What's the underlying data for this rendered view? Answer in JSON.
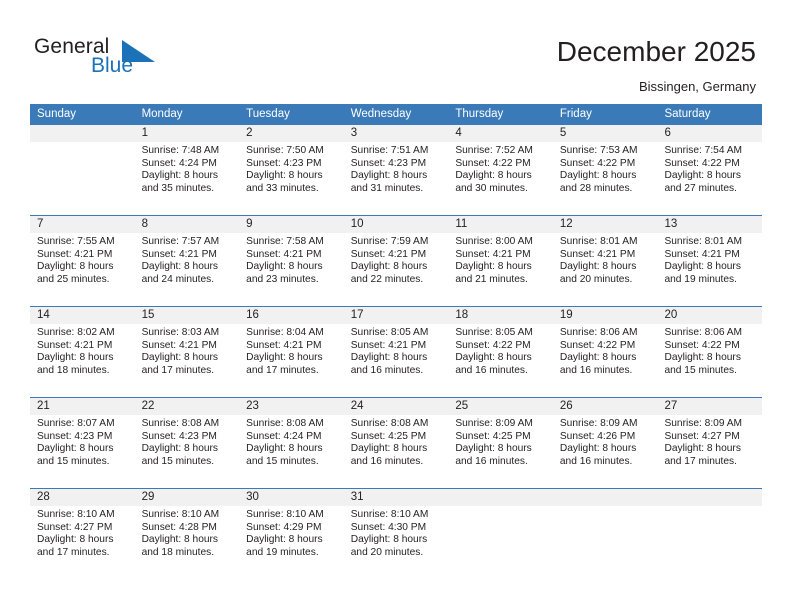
{
  "brand": {
    "name_part1": "General",
    "name_part2": "Blue",
    "mark_icon": "triangle-flag-icon"
  },
  "header": {
    "title": "December 2025",
    "subtitle": "Bissingen, Germany"
  },
  "calendar": {
    "day_headers": [
      "Sunday",
      "Monday",
      "Tuesday",
      "Wednesday",
      "Thursday",
      "Friday",
      "Saturday"
    ],
    "colors": {
      "header_blue": "#3b7ab8",
      "date_band": "#f1f1f1",
      "text": "#231f20",
      "brand_blue": "#1b72b8"
    },
    "weeks": [
      {
        "dates": [
          "",
          "1",
          "2",
          "3",
          "4",
          "5",
          "6"
        ],
        "details": [
          [],
          [
            "Sunrise: 7:48 AM",
            "Sunset: 4:24 PM",
            "Daylight: 8 hours",
            "and 35 minutes."
          ],
          [
            "Sunrise: 7:50 AM",
            "Sunset: 4:23 PM",
            "Daylight: 8 hours",
            "and 33 minutes."
          ],
          [
            "Sunrise: 7:51 AM",
            "Sunset: 4:23 PM",
            "Daylight: 8 hours",
            "and 31 minutes."
          ],
          [
            "Sunrise: 7:52 AM",
            "Sunset: 4:22 PM",
            "Daylight: 8 hours",
            "and 30 minutes."
          ],
          [
            "Sunrise: 7:53 AM",
            "Sunset: 4:22 PM",
            "Daylight: 8 hours",
            "and 28 minutes."
          ],
          [
            "Sunrise: 7:54 AM",
            "Sunset: 4:22 PM",
            "Daylight: 8 hours",
            "and 27 minutes."
          ]
        ]
      },
      {
        "dates": [
          "7",
          "8",
          "9",
          "10",
          "11",
          "12",
          "13"
        ],
        "details": [
          [
            "Sunrise: 7:55 AM",
            "Sunset: 4:21 PM",
            "Daylight: 8 hours",
            "and 25 minutes."
          ],
          [
            "Sunrise: 7:57 AM",
            "Sunset: 4:21 PM",
            "Daylight: 8 hours",
            "and 24 minutes."
          ],
          [
            "Sunrise: 7:58 AM",
            "Sunset: 4:21 PM",
            "Daylight: 8 hours",
            "and 23 minutes."
          ],
          [
            "Sunrise: 7:59 AM",
            "Sunset: 4:21 PM",
            "Daylight: 8 hours",
            "and 22 minutes."
          ],
          [
            "Sunrise: 8:00 AM",
            "Sunset: 4:21 PM",
            "Daylight: 8 hours",
            "and 21 minutes."
          ],
          [
            "Sunrise: 8:01 AM",
            "Sunset: 4:21 PM",
            "Daylight: 8 hours",
            "and 20 minutes."
          ],
          [
            "Sunrise: 8:01 AM",
            "Sunset: 4:21 PM",
            "Daylight: 8 hours",
            "and 19 minutes."
          ]
        ]
      },
      {
        "dates": [
          "14",
          "15",
          "16",
          "17",
          "18",
          "19",
          "20"
        ],
        "details": [
          [
            "Sunrise: 8:02 AM",
            "Sunset: 4:21 PM",
            "Daylight: 8 hours",
            "and 18 minutes."
          ],
          [
            "Sunrise: 8:03 AM",
            "Sunset: 4:21 PM",
            "Daylight: 8 hours",
            "and 17 minutes."
          ],
          [
            "Sunrise: 8:04 AM",
            "Sunset: 4:21 PM",
            "Daylight: 8 hours",
            "and 17 minutes."
          ],
          [
            "Sunrise: 8:05 AM",
            "Sunset: 4:21 PM",
            "Daylight: 8 hours",
            "and 16 minutes."
          ],
          [
            "Sunrise: 8:05 AM",
            "Sunset: 4:22 PM",
            "Daylight: 8 hours",
            "and 16 minutes."
          ],
          [
            "Sunrise: 8:06 AM",
            "Sunset: 4:22 PM",
            "Daylight: 8 hours",
            "and 16 minutes."
          ],
          [
            "Sunrise: 8:06 AM",
            "Sunset: 4:22 PM",
            "Daylight: 8 hours",
            "and 15 minutes."
          ]
        ]
      },
      {
        "dates": [
          "21",
          "22",
          "23",
          "24",
          "25",
          "26",
          "27"
        ],
        "details": [
          [
            "Sunrise: 8:07 AM",
            "Sunset: 4:23 PM",
            "Daylight: 8 hours",
            "and 15 minutes."
          ],
          [
            "Sunrise: 8:08 AM",
            "Sunset: 4:23 PM",
            "Daylight: 8 hours",
            "and 15 minutes."
          ],
          [
            "Sunrise: 8:08 AM",
            "Sunset: 4:24 PM",
            "Daylight: 8 hours",
            "and 15 minutes."
          ],
          [
            "Sunrise: 8:08 AM",
            "Sunset: 4:25 PM",
            "Daylight: 8 hours",
            "and 16 minutes."
          ],
          [
            "Sunrise: 8:09 AM",
            "Sunset: 4:25 PM",
            "Daylight: 8 hours",
            "and 16 minutes."
          ],
          [
            "Sunrise: 8:09 AM",
            "Sunset: 4:26 PM",
            "Daylight: 8 hours",
            "and 16 minutes."
          ],
          [
            "Sunrise: 8:09 AM",
            "Sunset: 4:27 PM",
            "Daylight: 8 hours",
            "and 17 minutes."
          ]
        ]
      },
      {
        "dates": [
          "28",
          "29",
          "30",
          "31",
          "",
          "",
          ""
        ],
        "details": [
          [
            "Sunrise: 8:10 AM",
            "Sunset: 4:27 PM",
            "Daylight: 8 hours",
            "and 17 minutes."
          ],
          [
            "Sunrise: 8:10 AM",
            "Sunset: 4:28 PM",
            "Daylight: 8 hours",
            "and 18 minutes."
          ],
          [
            "Sunrise: 8:10 AM",
            "Sunset: 4:29 PM",
            "Daylight: 8 hours",
            "and 19 minutes."
          ],
          [
            "Sunrise: 8:10 AM",
            "Sunset: 4:30 PM",
            "Daylight: 8 hours",
            "and 20 minutes."
          ],
          [],
          [],
          []
        ]
      }
    ]
  }
}
